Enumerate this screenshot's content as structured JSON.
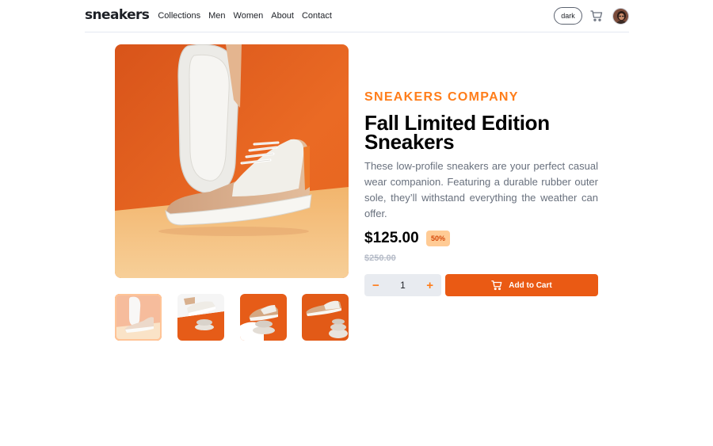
{
  "header": {
    "logo": "sneakers",
    "nav": [
      "Collections",
      "Men",
      "Women",
      "About",
      "Contact"
    ],
    "theme_toggle_label": "dark",
    "cart_icon": "cart-icon",
    "avatar_icon": "user-avatar"
  },
  "product": {
    "company": "SNEAKERS COMPANY",
    "title": "Fall Limited Edition Sneakers",
    "description": "These low-profile sneakers are your perfect casual wear companion. Featuring a durable rubber outer sole, they’ll withstand everything the weather can offer.",
    "price": "$125.00",
    "discount": "50%",
    "original_price": "$250.00",
    "quantity": "1",
    "decrement_label": "−",
    "increment_label": "+",
    "add_to_cart_label": "Add to Cart",
    "thumbnail_count": 4,
    "active_thumbnail": 1
  },
  "colors": {
    "accent": "#ff7d1a",
    "button": "#ea5a14",
    "discount_bg": "#ffcb95",
    "text_dark": "#1d2026",
    "text_muted": "#68707d"
  }
}
